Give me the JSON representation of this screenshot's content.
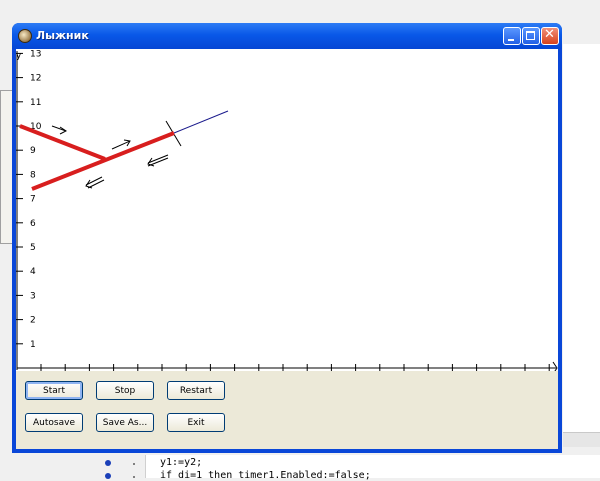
{
  "window": {
    "title": "Лыжник"
  },
  "plot": {
    "y_axis_label": "y",
    "y_ticks": [
      "1",
      "2",
      "3",
      "4",
      "5",
      "6",
      "7",
      "8",
      "9",
      "10",
      "11",
      "12",
      "13"
    ],
    "ski_color": "#d81e1e",
    "track_color": "#1a1a8c"
  },
  "buttons": {
    "start": "Start",
    "stop": "Stop",
    "restart": "Restart",
    "autosave": "Autosave",
    "save_as": "Save As...",
    "exit": "Exit"
  },
  "code_editor": {
    "lines": [
      "y1:=y2;",
      "if di=1 then timer1.Enabled:=false;"
    ]
  }
}
